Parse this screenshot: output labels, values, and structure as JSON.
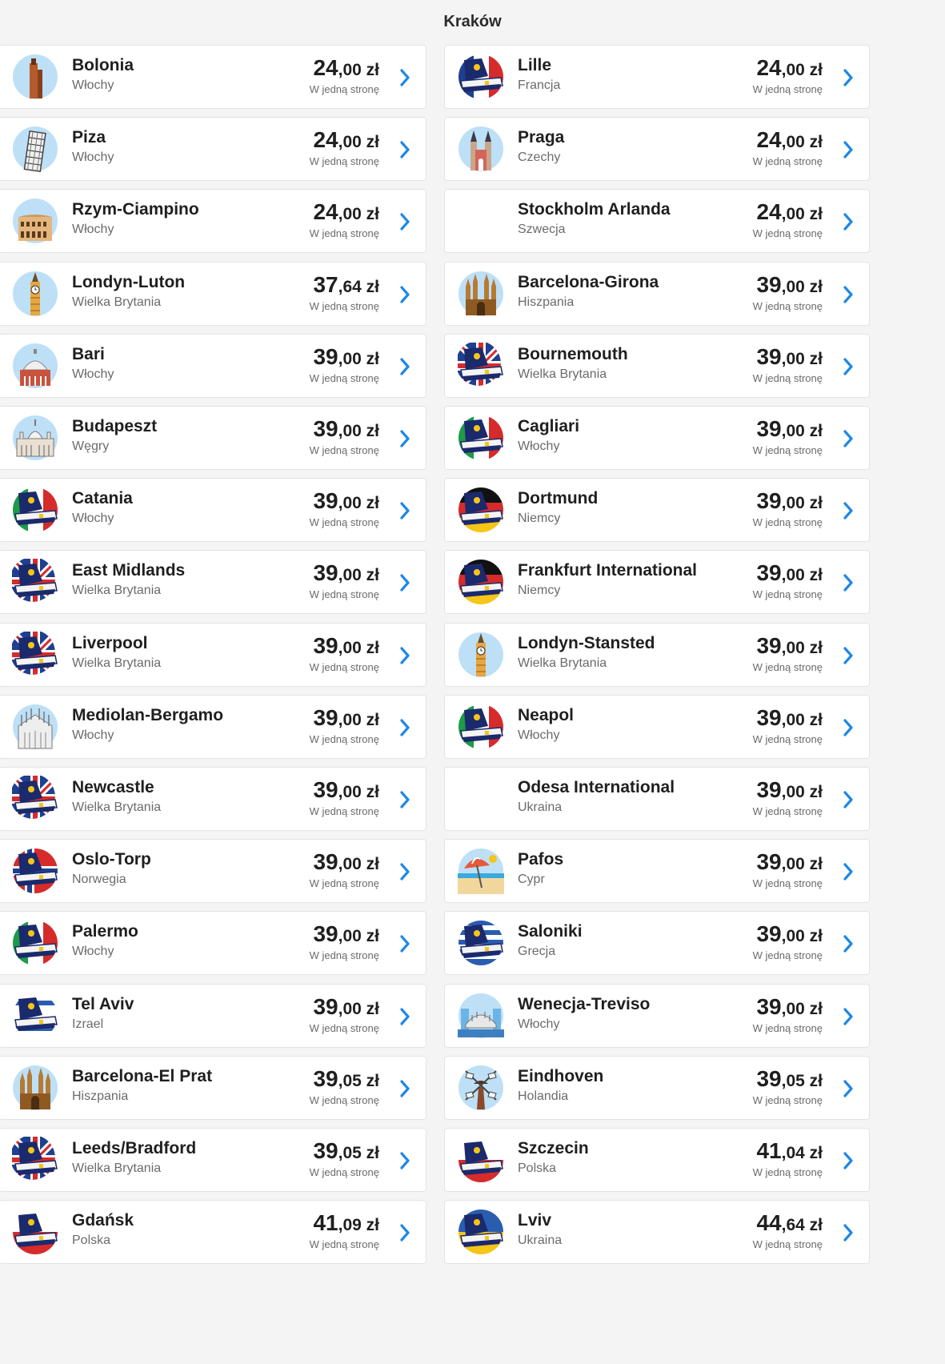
{
  "header": {
    "title": "Kraków"
  },
  "labels": {
    "one_way": "W jedną stronę",
    "currency": "zł"
  },
  "colors": {
    "accent": "#1e88e5",
    "card_bg": "#ffffff",
    "page_bg": "#f4f4f4"
  },
  "destinations": [
    {
      "city": "Bolonia",
      "country": "Włochy",
      "price_int": "24",
      "price_dec": ",00",
      "icon": "bologna-tower-icon"
    },
    {
      "city": "Lille",
      "country": "Francja",
      "price_int": "24",
      "price_dec": ",00",
      "icon": "ryanair-tail-france-icon"
    },
    {
      "city": "Piza",
      "country": "Włochy",
      "price_int": "24",
      "price_dec": ",00",
      "icon": "leaning-tower-icon"
    },
    {
      "city": "Praga",
      "country": "Czechy",
      "price_int": "24",
      "price_dec": ",00",
      "icon": "prague-church-icon"
    },
    {
      "city": "Rzym-Ciampino",
      "country": "Włochy",
      "price_int": "24",
      "price_dec": ",00",
      "icon": "colosseum-icon"
    },
    {
      "city": "Stockholm Arlanda",
      "country": "Szwecja",
      "price_int": "24",
      "price_dec": ",00",
      "icon": "none"
    },
    {
      "city": "Londyn-Luton",
      "country": "Wielka Brytania",
      "price_int": "37",
      "price_dec": ",64",
      "icon": "big-ben-icon"
    },
    {
      "city": "Barcelona-Girona",
      "country": "Hiszpania",
      "price_int": "39",
      "price_dec": ",00",
      "icon": "sagrada-familia-icon"
    },
    {
      "city": "Bari",
      "country": "Włochy",
      "price_int": "39",
      "price_dec": ",00",
      "icon": "dome-building-icon"
    },
    {
      "city": "Bournemouth",
      "country": "Wielka Brytania",
      "price_int": "39",
      "price_dec": ",00",
      "icon": "ryanair-tail-uk-icon"
    },
    {
      "city": "Budapeszt",
      "country": "Węgry",
      "price_int": "39",
      "price_dec": ",00",
      "icon": "parliament-icon"
    },
    {
      "city": "Cagliari",
      "country": "Włochy",
      "price_int": "39",
      "price_dec": ",00",
      "icon": "ryanair-tail-italy-icon"
    },
    {
      "city": "Catania",
      "country": "Włochy",
      "price_int": "39",
      "price_dec": ",00",
      "icon": "ryanair-tail-italy-icon"
    },
    {
      "city": "Dortmund",
      "country": "Niemcy",
      "price_int": "39",
      "price_dec": ",00",
      "icon": "ryanair-tail-germany-icon"
    },
    {
      "city": "East Midlands",
      "country": "Wielka Brytania",
      "price_int": "39",
      "price_dec": ",00",
      "icon": "ryanair-tail-uk-icon"
    },
    {
      "city": "Frankfurt International",
      "country": "Niemcy",
      "price_int": "39",
      "price_dec": ",00",
      "icon": "ryanair-tail-germany-icon"
    },
    {
      "city": "Liverpool",
      "country": "Wielka Brytania",
      "price_int": "39",
      "price_dec": ",00",
      "icon": "ryanair-tail-uk-icon"
    },
    {
      "city": "Londyn-Stansted",
      "country": "Wielka Brytania",
      "price_int": "39",
      "price_dec": ",00",
      "icon": "big-ben-icon"
    },
    {
      "city": "Mediolan-Bergamo",
      "country": "Włochy",
      "price_int": "39",
      "price_dec": ",00",
      "icon": "milan-cathedral-icon"
    },
    {
      "city": "Neapol",
      "country": "Włochy",
      "price_int": "39",
      "price_dec": ",00",
      "icon": "ryanair-tail-italy-icon"
    },
    {
      "city": "Newcastle",
      "country": "Wielka Brytania",
      "price_int": "39",
      "price_dec": ",00",
      "icon": "ryanair-tail-uk-icon"
    },
    {
      "city": "Odesa International",
      "country": "Ukraina",
      "price_int": "39",
      "price_dec": ",00",
      "icon": "none"
    },
    {
      "city": "Oslo-Torp",
      "country": "Norwegia",
      "price_int": "39",
      "price_dec": ",00",
      "icon": "ryanair-tail-norway-icon"
    },
    {
      "city": "Pafos",
      "country": "Cypr",
      "price_int": "39",
      "price_dec": ",00",
      "icon": "beach-umbrella-icon"
    },
    {
      "city": "Palermo",
      "country": "Włochy",
      "price_int": "39",
      "price_dec": ",00",
      "icon": "ryanair-tail-italy-icon"
    },
    {
      "city": "Saloniki",
      "country": "Grecja",
      "price_int": "39",
      "price_dec": ",00",
      "icon": "ryanair-tail-greece-icon"
    },
    {
      "city": "Tel Aviv",
      "country": "Izrael",
      "price_int": "39",
      "price_dec": ",00",
      "icon": "ryanair-tail-israel-icon"
    },
    {
      "city": "Wenecja-Treviso",
      "country": "Włochy",
      "price_int": "39",
      "price_dec": ",00",
      "icon": "venice-bridge-icon"
    },
    {
      "city": "Barcelona-El Prat",
      "country": "Hiszpania",
      "price_int": "39",
      "price_dec": ",05",
      "icon": "sagrada-familia-icon"
    },
    {
      "city": "Eindhoven",
      "country": "Holandia",
      "price_int": "39",
      "price_dec": ",05",
      "icon": "windmill-icon"
    },
    {
      "city": "Leeds/Bradford",
      "country": "Wielka Brytania",
      "price_int": "39",
      "price_dec": ",05",
      "icon": "ryanair-tail-uk-icon"
    },
    {
      "city": "Szczecin",
      "country": "Polska",
      "price_int": "41",
      "price_dec": ",04",
      "icon": "ryanair-tail-poland-icon"
    },
    {
      "city": "Gdańsk",
      "country": "Polska",
      "price_int": "41",
      "price_dec": ",09",
      "icon": "ryanair-tail-poland-icon"
    },
    {
      "city": "Lviv",
      "country": "Ukraina",
      "price_int": "44",
      "price_dec": ",64",
      "icon": "ryanair-tail-ukraine-icon"
    }
  ]
}
